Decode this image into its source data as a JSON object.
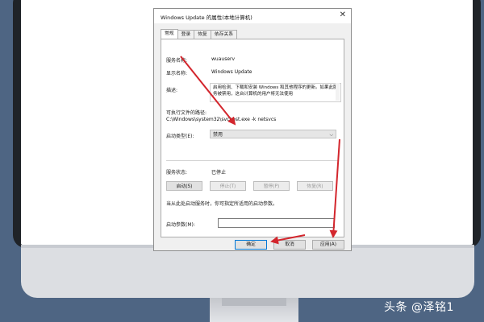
{
  "dialog": {
    "title": "Windows Update 的属性(本地计算机)",
    "close_glyph": "✕",
    "tabs": [
      "常规",
      "登录",
      "恢复",
      "依存关系"
    ],
    "service_name_label": "服务名称:",
    "service_name_value": "wuauserv",
    "display_name_label": "显示名称:",
    "display_name_value": "Windows Update",
    "description_label": "描述:",
    "description_value": "启用检测、下载和安装 Windows 和其他程序的更新。如果此服务被禁用，这台计算机的用户将无法使用",
    "path_label": "可执行文件的路径:",
    "path_value": "C:\\Windows\\system32\\svchost.exe -k netsvcs",
    "startup_type_label": "启动类型(E):",
    "startup_type_value": "禁用",
    "service_status_label": "服务状态:",
    "service_status_value": "已停止",
    "start_button": "启动(S)",
    "stop_button": "停止(T)",
    "pause_button": "暂停(P)",
    "resume_button": "恢复(R)",
    "hint_text": "当从此处启动服务时，你可指定所适用的启动参数。",
    "start_params_label": "启动参数(M):",
    "start_params_value": "",
    "ok_button": "确定",
    "cancel_button": "取消",
    "apply_button": "应用(A)"
  },
  "watermark": "头条 @泽铭1",
  "colors": {
    "background": "#4e6583",
    "arrow": "#d3262d",
    "dialog_focus": "#0078d7"
  }
}
